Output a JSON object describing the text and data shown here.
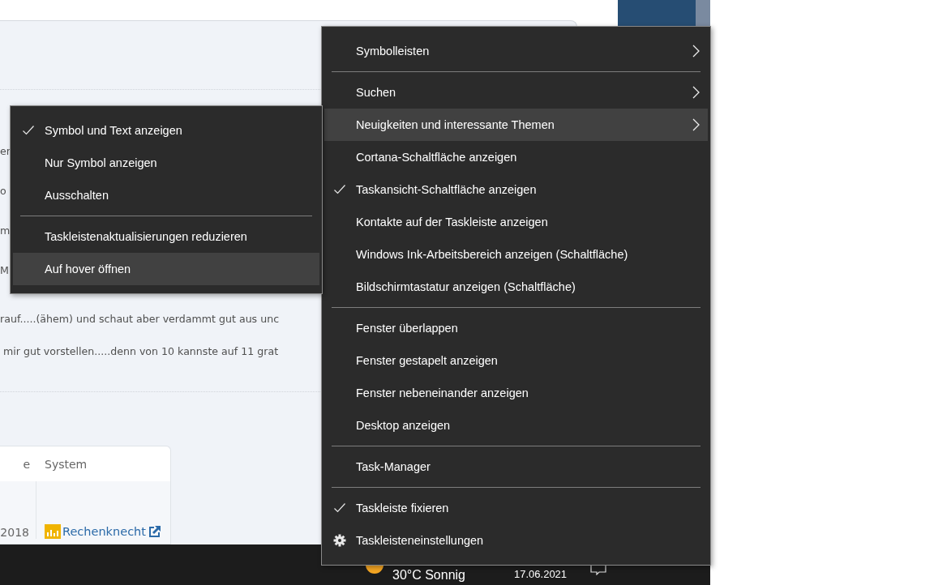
{
  "page": {
    "text_lines": [
      "er",
      "o",
      "m",
      "M",
      "rauf.....(ähem) und schaut aber verdammt gut aus unc",
      "mir gut vorstellen.....denn von 10 kannste auf 11 grat"
    ],
    "table": {
      "columns": [
        "e",
        "System"
      ],
      "rows": [
        {
          "cells": [
            "2018",
            "Rechenknecht"
          ]
        }
      ]
    }
  },
  "taskbar": {
    "weather": "30°C Sonnig",
    "date": "17.06.2021"
  },
  "context_menu": {
    "items": [
      {
        "kind": "item",
        "label": "Symbolleisten",
        "checked": false,
        "submenu": true,
        "selected": false
      },
      {
        "kind": "separator"
      },
      {
        "kind": "item",
        "label": "Suchen",
        "checked": false,
        "submenu": true,
        "selected": false
      },
      {
        "kind": "item",
        "label": "Neuigkeiten und interessante Themen",
        "checked": false,
        "submenu": true,
        "selected": true
      },
      {
        "kind": "item",
        "label": "Cortana-Schaltfläche anzeigen",
        "checked": false,
        "submenu": false,
        "selected": false
      },
      {
        "kind": "item",
        "label": "Taskansicht-Schaltfläche anzeigen",
        "checked": true,
        "submenu": false,
        "selected": false
      },
      {
        "kind": "item",
        "label": "Kontakte auf der Taskleiste anzeigen",
        "checked": false,
        "submenu": false,
        "selected": false
      },
      {
        "kind": "item",
        "label": "Windows Ink-Arbeitsbereich anzeigen (Schaltfläche)",
        "checked": false,
        "submenu": false,
        "selected": false
      },
      {
        "kind": "item",
        "label": "Bildschirmtastatur anzeigen (Schaltfläche)",
        "checked": false,
        "submenu": false,
        "selected": false
      },
      {
        "kind": "separator"
      },
      {
        "kind": "item",
        "label": "Fenster überlappen",
        "checked": false,
        "submenu": false,
        "selected": false
      },
      {
        "kind": "item",
        "label": "Fenster gestapelt anzeigen",
        "checked": false,
        "submenu": false,
        "selected": false
      },
      {
        "kind": "item",
        "label": "Fenster nebeneinander anzeigen",
        "checked": false,
        "submenu": false,
        "selected": false
      },
      {
        "kind": "item",
        "label": "Desktop anzeigen",
        "checked": false,
        "submenu": false,
        "selected": false
      },
      {
        "kind": "separator"
      },
      {
        "kind": "item",
        "label": "Task-Manager",
        "checked": false,
        "submenu": false,
        "selected": false
      },
      {
        "kind": "separator"
      },
      {
        "kind": "item",
        "label": "Taskleiste fixieren",
        "checked": true,
        "submenu": false,
        "selected": false
      },
      {
        "kind": "gear",
        "label": "Taskleisteneinstellungen",
        "checked": false,
        "submenu": false,
        "selected": false
      }
    ]
  },
  "submenu": {
    "items": [
      {
        "kind": "item",
        "label": "Symbol und Text anzeigen",
        "checked": true,
        "submenu": false,
        "selected": false
      },
      {
        "kind": "item",
        "label": "Nur Symbol anzeigen",
        "checked": false,
        "submenu": false,
        "selected": false
      },
      {
        "kind": "item",
        "label": "Ausschalten",
        "checked": false,
        "submenu": false,
        "selected": false
      },
      {
        "kind": "separator"
      },
      {
        "kind": "item",
        "label": "Taskleistenaktualisierungen reduzieren",
        "checked": false,
        "submenu": false,
        "selected": false
      },
      {
        "kind": "item",
        "label": "Auf hover öffnen",
        "checked": false,
        "submenu": false,
        "selected": true
      }
    ]
  }
}
